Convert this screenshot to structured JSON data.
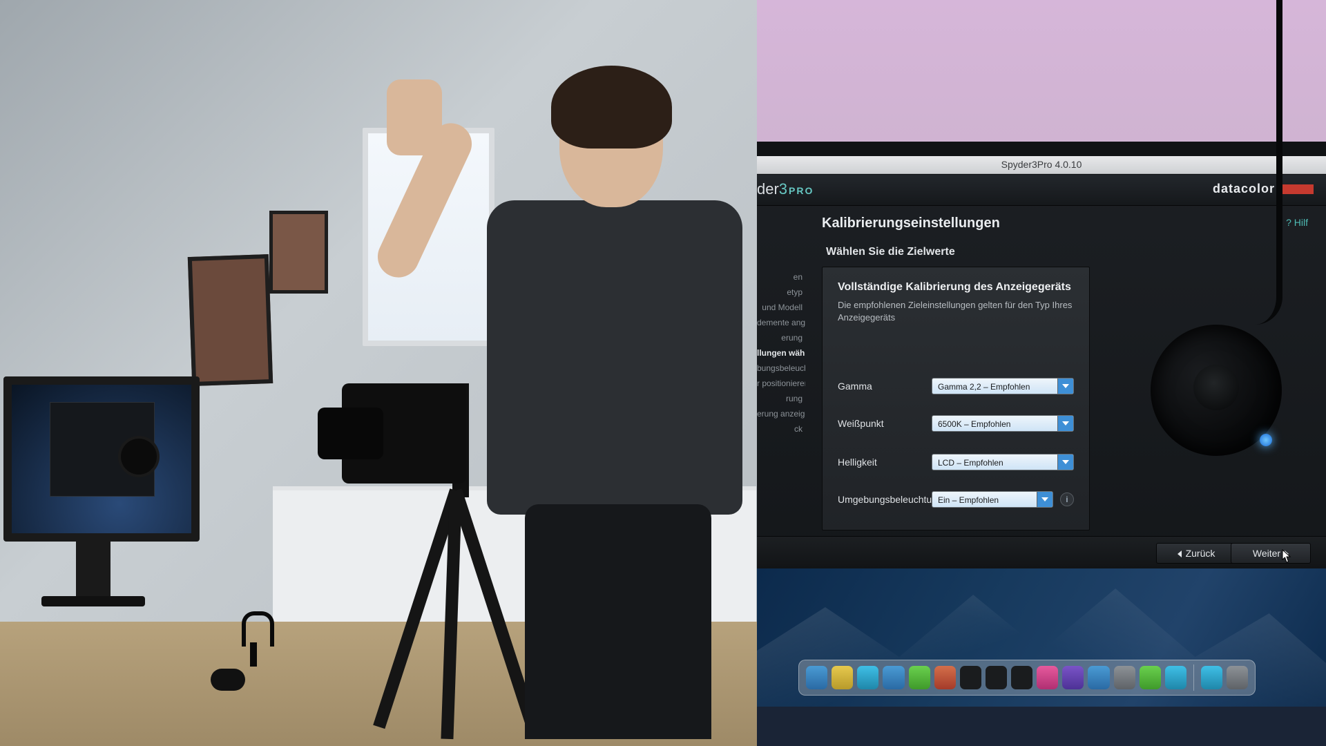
{
  "window": {
    "title": "Spyder3Pro 4.0.10"
  },
  "brand": {
    "product_prefix": "der",
    "product_number": "3",
    "product_suffix": "PRO",
    "company": "datacolor"
  },
  "page": {
    "title": "Kalibrierungseinstellungen",
    "help": "Hilf",
    "subtitle": "Wählen Sie die Zielwerte"
  },
  "wizard_steps": [
    {
      "label": "en",
      "active": false
    },
    {
      "label": "etyp",
      "active": false
    },
    {
      "label": "und Modell",
      "active": false
    },
    {
      "label": "demente angeben",
      "active": false
    },
    {
      "label": "erung",
      "active": false
    },
    {
      "label": "llungen wählen",
      "active": true
    },
    {
      "label": "bungsbeleuchtung",
      "active": false
    },
    {
      "label": "r positionieren",
      "active": false
    },
    {
      "label": "rung",
      "active": false
    },
    {
      "label": "erung anzeigen",
      "active": false
    },
    {
      "label": "ck",
      "active": false
    }
  ],
  "card": {
    "heading": "Vollständige Kalibrierung des Anzeigegeräts",
    "description": "Die empfohlenen Zieleinstellungen gelten für den Typ Ihres Anzeigegeräts"
  },
  "fields": {
    "gamma": {
      "label": "Gamma",
      "value": "Gamma 2,2 – Empfohlen"
    },
    "whitepoint": {
      "label": "Weißpunkt",
      "value": "6500K – Empfohlen"
    },
    "brightness": {
      "label": "Helligkeit",
      "value": "LCD – Empfohlen"
    },
    "ambient": {
      "label": "Umgebungsbeleuchtu",
      "value": "Ein – Empfohlen"
    }
  },
  "buttons": {
    "back": "Zurück",
    "next": "Weiter"
  },
  "dock_icons": [
    {
      "name": "finder-icon"
    },
    {
      "name": "launchpad-icon"
    },
    {
      "name": "safari-icon"
    },
    {
      "name": "mail-icon"
    },
    {
      "name": "messages-icon"
    },
    {
      "name": "calendar-icon"
    },
    {
      "name": "lightroom-icon"
    },
    {
      "name": "photoshop-icon"
    },
    {
      "name": "bridge-icon"
    },
    {
      "name": "photos-icon"
    },
    {
      "name": "itunes-icon"
    },
    {
      "name": "appstore-icon"
    },
    {
      "name": "preview-icon"
    },
    {
      "name": "spotify-icon"
    },
    {
      "name": "skype-icon"
    },
    {
      "name": "folder-icon"
    },
    {
      "name": "trash-icon"
    }
  ]
}
